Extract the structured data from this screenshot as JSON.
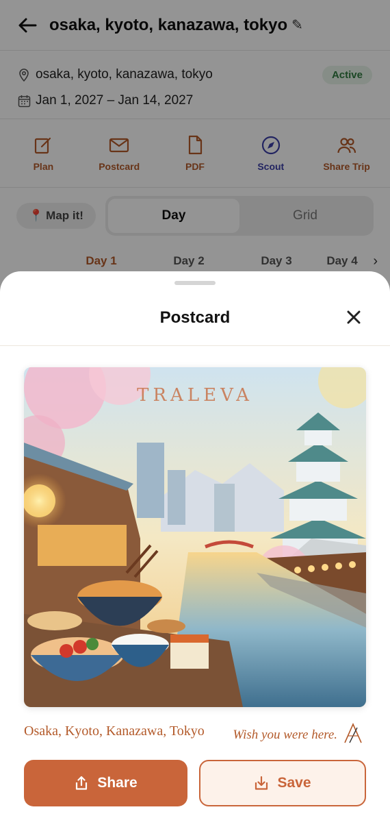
{
  "header": {
    "title": "osaka, kyoto, kanazawa, tokyo",
    "edit_glyph": "✎"
  },
  "trip": {
    "locations": "osaka, kyoto, kanazawa, tokyo",
    "dates": "Jan 1, 2027 – Jan 14, 2027",
    "status": "Active"
  },
  "actions": [
    {
      "label": "Plan",
      "icon": "edit-square-icon"
    },
    {
      "label": "Postcard",
      "icon": "envelope-icon"
    },
    {
      "label": "PDF",
      "icon": "document-icon"
    },
    {
      "label": "Scout",
      "icon": "compass-icon"
    },
    {
      "label": "Share Trip",
      "icon": "people-icon"
    }
  ],
  "view_toggle": {
    "map_label": "Map it!",
    "options": [
      "Day",
      "Grid"
    ],
    "selected": "Day"
  },
  "day_tabs": [
    "Day 1",
    "Day 2",
    "Day 3",
    "Day 4"
  ],
  "selected_day": "Day 1",
  "sheet": {
    "title": "Postcard",
    "watermark": "TRALEVA",
    "caption_left": "Osaka, Kyoto, Kanazawa, Tokyo",
    "caption_right": "Wish you were here.",
    "share_label": "Share",
    "save_label": "Save"
  },
  "colors": {
    "accent": "#c9653a",
    "scout": "#3b3fa8",
    "active_badge_bg": "#e7f3e9",
    "active_badge_text": "#2f7a3f"
  }
}
